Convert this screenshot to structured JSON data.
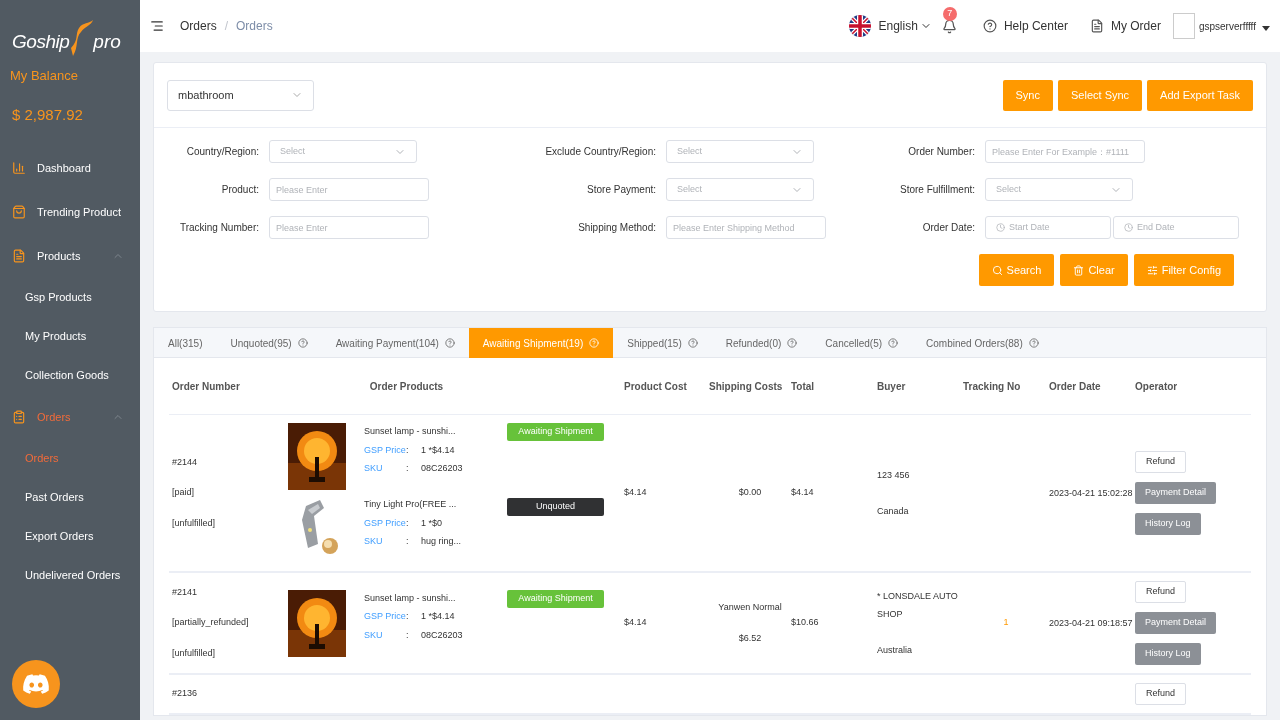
{
  "logo": {
    "word": "Goship",
    "suffix": "pro"
  },
  "balance": {
    "label": "My Balance",
    "amount": "$ 2,987.92"
  },
  "sidebar": {
    "items": [
      {
        "label": "Dashboard",
        "selected": false
      },
      {
        "label": "Trending Product",
        "selected": false
      },
      {
        "label": "Products",
        "selected": false,
        "expanded": true,
        "children": [
          {
            "label": "Gsp Products",
            "selected": false
          },
          {
            "label": "My Products",
            "selected": false
          },
          {
            "label": "Collection Goods",
            "selected": false
          }
        ]
      },
      {
        "label": "Orders",
        "selected": true,
        "expanded": true,
        "children": [
          {
            "label": "Orders",
            "selected": true
          },
          {
            "label": "Past Orders",
            "selected": false
          },
          {
            "label": "Export Orders",
            "selected": false
          },
          {
            "label": "Undelivered Orders",
            "selected": false
          }
        ]
      }
    ]
  },
  "breadcrumb": [
    "Orders",
    "Orders"
  ],
  "breadcrumb_separator": "/",
  "header": {
    "language": "English",
    "notifications": "7",
    "help": "Help Center",
    "my_order": "My Order",
    "user": "gspserverfffff"
  },
  "store_select": {
    "value": "mbathroom"
  },
  "top_actions": [
    "Sync",
    "Select Sync",
    "Add Export Task"
  ],
  "filters": [
    {
      "label": "Country/Region:",
      "kind": "select",
      "placeholder": "Select"
    },
    {
      "label": "Exclude Country/Region:",
      "kind": "select",
      "placeholder": "Select"
    },
    {
      "label": "Order Number:",
      "kind": "input",
      "placeholder": "Please Enter For Example：#1111"
    },
    {
      "label": "Product:",
      "kind": "input",
      "placeholder": "Please Enter"
    },
    {
      "label": "Store Payment:",
      "kind": "select",
      "placeholder": "Select"
    },
    {
      "label": "Store Fulfillment:",
      "kind": "select",
      "placeholder": "Select"
    },
    {
      "label": "Tracking Number:",
      "kind": "input",
      "placeholder": "Please Enter"
    },
    {
      "label": "Shipping Method:",
      "kind": "input",
      "placeholder": "Please Enter Shipping Method"
    },
    {
      "label": "Order Date:",
      "kind": "daterange",
      "placeholder": "Start Date",
      "placeholder_end": "End Date"
    }
  ],
  "filter_actions": [
    {
      "label": "Search"
    },
    {
      "label": "Clear"
    },
    {
      "label": "Filter Config"
    }
  ],
  "tabs": [
    {
      "label": "All(315)",
      "selected": false,
      "help": false
    },
    {
      "label": "Unquoted(95)",
      "selected": false,
      "help": true
    },
    {
      "label": "Awaiting Payment(104)",
      "selected": false,
      "help": true
    },
    {
      "label": "Awaiting Shipment(19)",
      "selected": true,
      "help": true
    },
    {
      "label": "Shipped(15)",
      "selected": false,
      "help": true
    },
    {
      "label": "Refunded(0)",
      "selected": false,
      "help": true
    },
    {
      "label": "Cancelled(5)",
      "selected": false,
      "help": true
    },
    {
      "label": "Combined Orders(88)",
      "selected": false,
      "help": true
    }
  ],
  "table": {
    "columns": [
      "Order Number",
      "Order Products",
      "Product Cost",
      "Shipping Costs",
      "Total",
      "Buyer",
      "Tracking No",
      "Order Date",
      "Operator"
    ],
    "rows": [
      {
        "order": [
          "#2144",
          "[paid]",
          "[unfulfilled]"
        ],
        "products": [
          {
            "name": "Sunset lamp - sunshi...",
            "price_label": "GSP Price",
            "price": "1 *$4.14",
            "sku_label": "SKU",
            "sku": "08C26203",
            "sep": [
              ":",
              ":"
            ],
            "status": {
              "kind": "awaiting",
              "label": "Awaiting Shipment"
            }
          },
          {
            "name": "Tiny Light Pro(FREE ...",
            "price_label": "GSP Price",
            "price": "1 *$0",
            "sku_label": "SKU",
            "sku": "hug ring...",
            "sep": [
              ":",
              ":"
            ],
            "status": {
              "kind": "unquoted",
              "label": "Unquoted"
            }
          }
        ],
        "product_cost": "$4.14",
        "shipping": [
          "$0.00"
        ],
        "total": "$4.14",
        "buyer": [
          "123 456",
          "Canada"
        ],
        "tracking": "",
        "date": "2023-04-21 15:02:28",
        "buttons": [
          {
            "label": "Refund",
            "kind": "outline"
          },
          {
            "label": "Payment Detail",
            "kind": "gray"
          },
          {
            "label": "History Log",
            "kind": "gray"
          }
        ]
      },
      {
        "order": [
          "#2141",
          "[partially_refunded]",
          "[unfulfilled]"
        ],
        "products": [
          {
            "name": "Sunset lamp - sunshi...",
            "price_label": "GSP Price",
            "price": "1 *$4.14",
            "sku_label": "SKU",
            "sku": "08C26203",
            "sep": [
              ":",
              ":"
            ],
            "status": {
              "kind": "awaiting",
              "label": "Awaiting Shipment"
            }
          }
        ],
        "product_cost": "$4.14",
        "shipping": [
          "Yanwen Normal",
          "$6.52"
        ],
        "total": "$10.66",
        "buyer": [
          "* LONSDALE AUTO SHOP",
          "Australia"
        ],
        "tracking": "1",
        "date": "2023-04-21 09:18:57",
        "buttons": [
          {
            "label": "Refund",
            "kind": "outline"
          },
          {
            "label": "Payment Detail",
            "kind": "gray"
          },
          {
            "label": "History Log",
            "kind": "gray"
          }
        ]
      },
      {
        "order": [
          "#2136"
        ],
        "products": [],
        "product_cost": "",
        "shipping": [],
        "total": "",
        "buyer": [],
        "tracking": "",
        "date": "",
        "buttons": [
          {
            "label": "Refund",
            "kind": "outline"
          }
        ]
      }
    ]
  }
}
